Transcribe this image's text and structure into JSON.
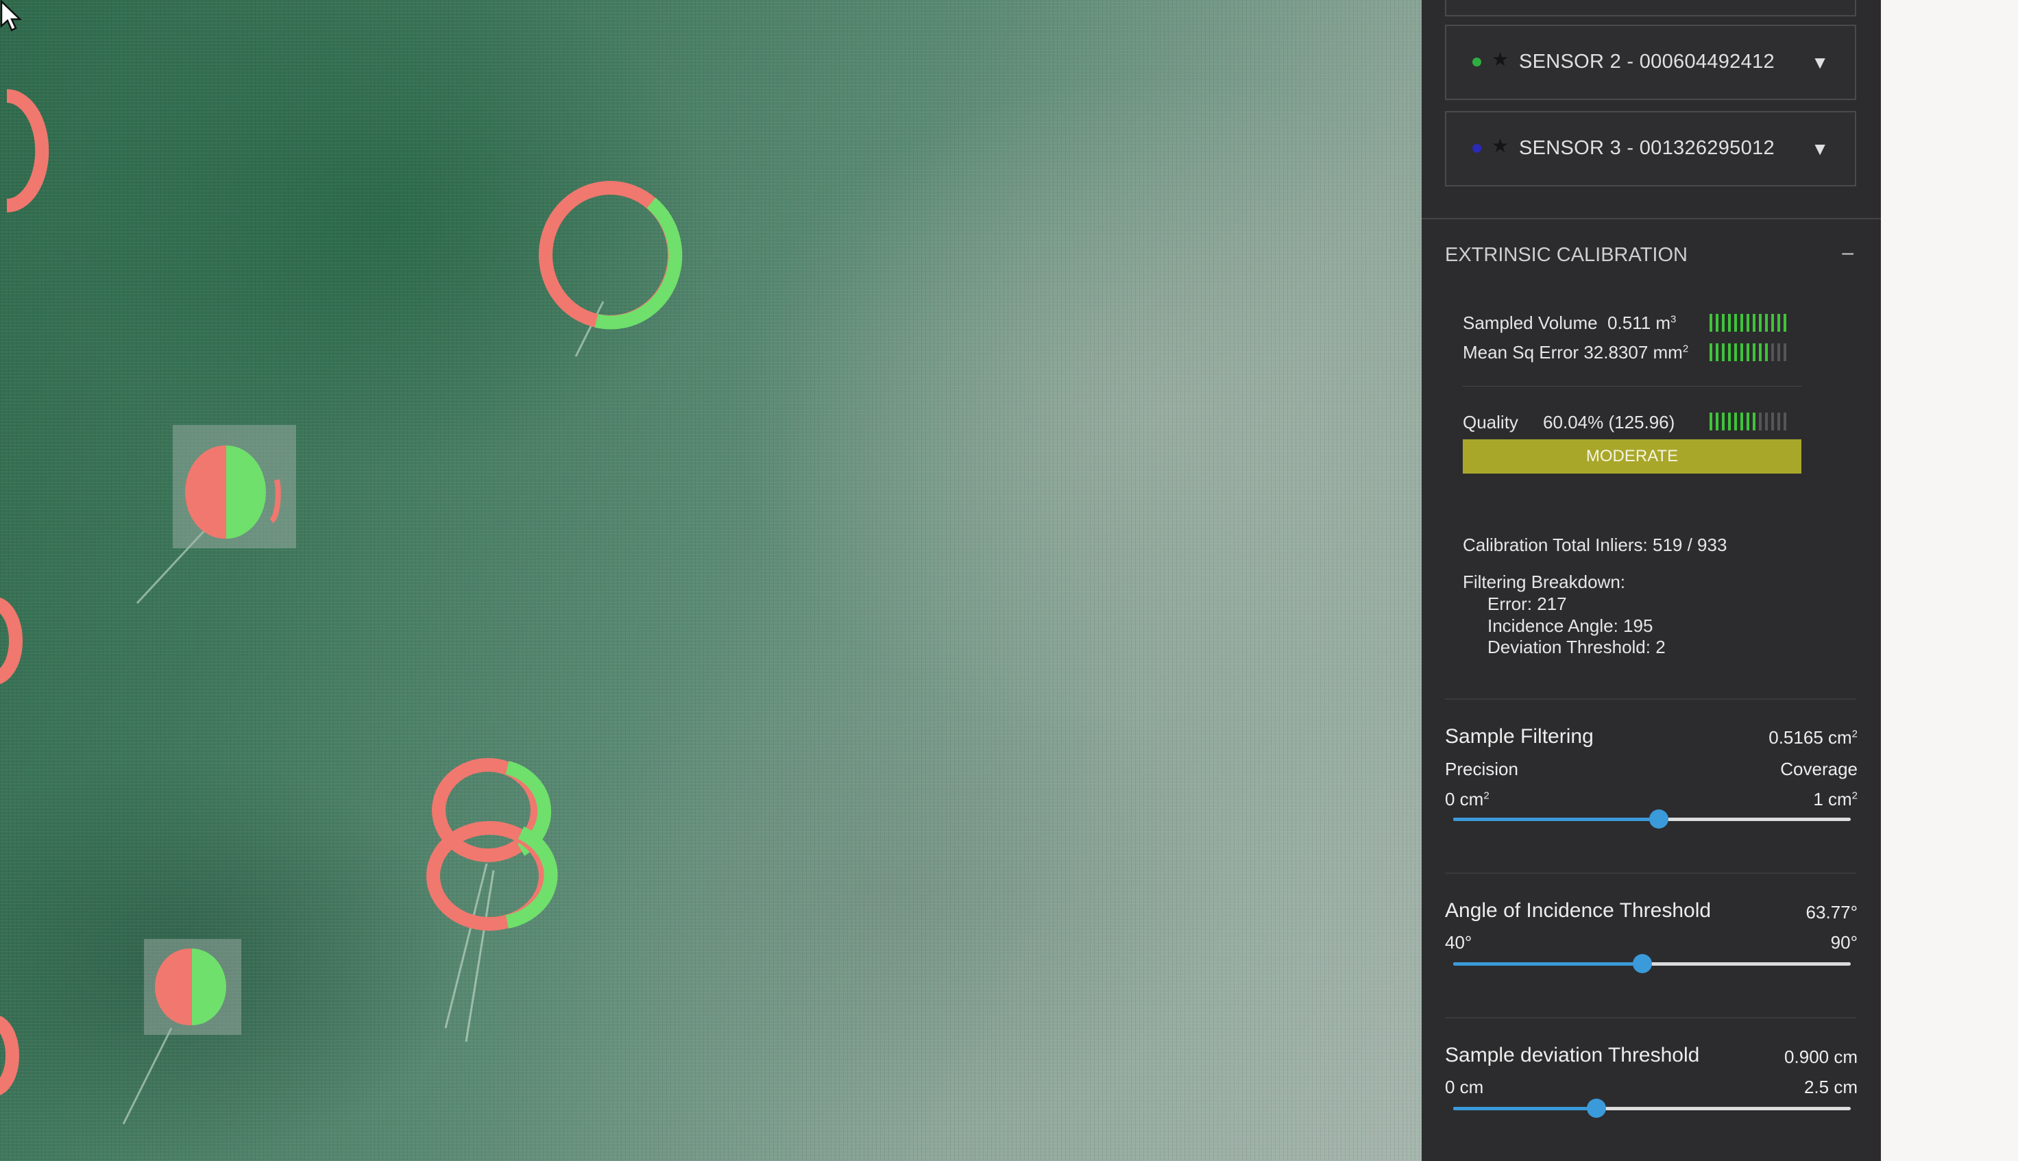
{
  "sensors": [
    {
      "label": "SENSOR 2 - 000604492412",
      "dot_color": "#2fae3f"
    },
    {
      "label": "SENSOR 3 - 001326295012",
      "dot_color": "#2a2ab8"
    }
  ],
  "extrinsic": {
    "title": "EXTRINSIC CALIBRATION",
    "collapse_symbol": "–",
    "sampled_volume_label": "Sampled Volume",
    "sampled_volume_value": "0.511 m",
    "sampled_volume_unit_exp": "3",
    "sampled_volume_level": 1.0,
    "mse_label": "Mean Sq Error",
    "mse_value": "32.8307 mm",
    "mse_unit_exp": "2",
    "mse_level": 0.8,
    "quality_label": "Quality",
    "quality_value": "60.04% (125.96)",
    "quality_level": 0.6,
    "quality_rating": "MODERATE",
    "inliers": "Calibration Total Inliers: 519 / 933",
    "filtering_title": "Filtering Breakdown:",
    "filtering_error": "Error: 217",
    "filtering_incidence": "Incidence Angle: 195",
    "filtering_deviation": "Deviation Threshold: 2"
  },
  "sample_filtering": {
    "title": "Sample Filtering",
    "value": "0.5165 cm",
    "value_exp": "2",
    "left_label": "Precision",
    "right_label": "Coverage",
    "min": "0 cm",
    "min_exp": "2",
    "max": "1 cm",
    "max_exp": "2",
    "fraction": 0.5165
  },
  "angle_threshold": {
    "title": "Angle of Incidence Threshold",
    "value": "63.77°",
    "min": "40°",
    "max": "90°",
    "fraction": 0.4754
  },
  "deviation_threshold": {
    "title": "Sample deviation Threshold",
    "value": "0.900 cm",
    "min": "0 cm",
    "max": "2.5 cm",
    "fraction": 0.36
  },
  "colors": {
    "accent_blue": "#3b9ad9",
    "meter_green": "#3fc43a",
    "meter_off": "#555558",
    "quality_yellow": "#a9a72a",
    "marker_red": "#f0786e",
    "marker_green": "#6fe06b"
  }
}
